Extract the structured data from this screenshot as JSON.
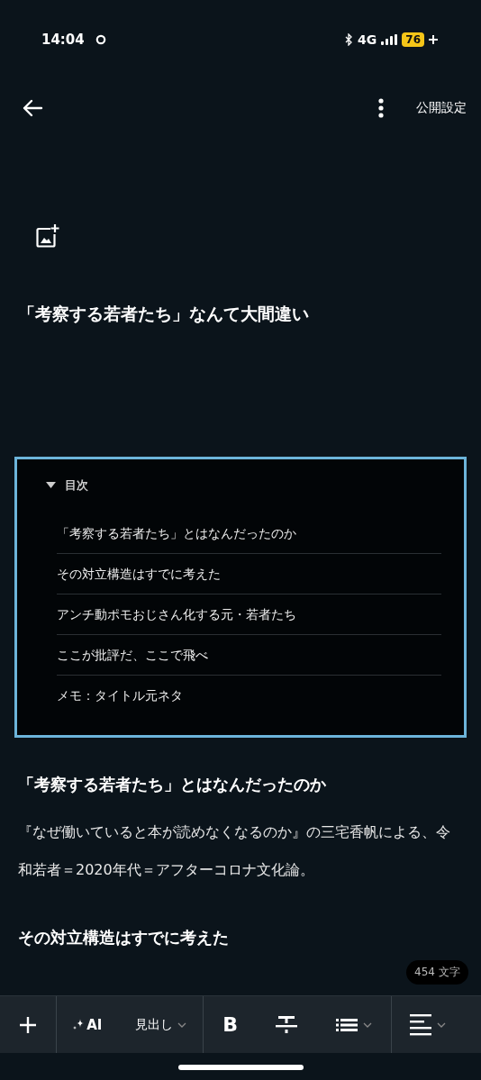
{
  "status_bar": {
    "time": "14:04",
    "network": "4G",
    "battery": "76"
  },
  "header": {
    "publish_label": "公開設定"
  },
  "title": "「考察する若者たち」なんて大間違い",
  "toc": {
    "heading": "目次",
    "expanded": true,
    "items": [
      {
        "label": "「考察する若者たち」とはなんだったのか"
      },
      {
        "label": "その対立構造はすでに考えた"
      },
      {
        "label": "アンチ動ポモおじさん化する元・若者たち"
      },
      {
        "label": "ここが批評だ、ここで飛べ"
      },
      {
        "label": "メモ：タイトル元ネタ"
      }
    ]
  },
  "body": [
    {
      "kind": "heading",
      "text": "「考察する若者たち」とはなんだったのか"
    },
    {
      "kind": "paragraph",
      "text": "『なぜ働いていると本が読めなくなるのか』の三宅香帆による、令和若者＝2020年代＝アフターコロナ文化論。"
    },
    {
      "kind": "heading",
      "text": "その対立構造はすでに考えた"
    }
  ],
  "char_count": "454 文字",
  "toolbar": {
    "ai_label": "AI",
    "heading_label": "見出し",
    "bold_label": "B"
  }
}
